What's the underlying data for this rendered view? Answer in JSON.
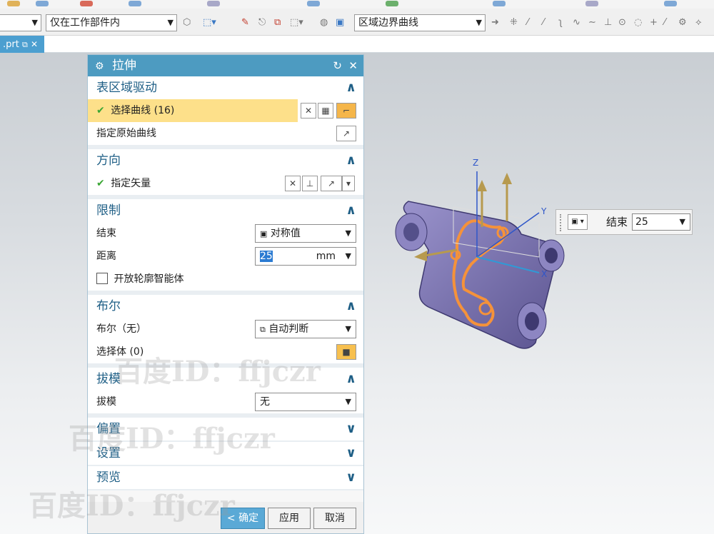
{
  "toolbar": {
    "filter_label": "仅在工作部件内",
    "curve_rule_label": "区域边界曲线"
  },
  "tab": {
    "label": ".prt"
  },
  "dialog": {
    "title": "拉伸",
    "sections": {
      "region": {
        "title": "表区域驱动",
        "select_curve": "选择曲线 (16)",
        "specify_original": "指定原始曲线"
      },
      "direction": {
        "title": "方向",
        "specify_vector": "指定矢量"
      },
      "limits": {
        "title": "限制",
        "end_label": "结束",
        "end_value": "对称值",
        "distance_label": "距离",
        "distance_value": "25",
        "distance_unit": "mm",
        "open_profile_label": "开放轮廓智能体"
      },
      "boolean": {
        "title": "布尔",
        "boolean_label": "布尔（无）",
        "boolean_value": "自动判断",
        "select_body": "选择体 (0)"
      },
      "draft": {
        "title": "拔模",
        "draft_label": "拔模",
        "draft_value": "无"
      },
      "offset": {
        "title": "偏置"
      },
      "settings": {
        "title": "设置"
      },
      "preview": {
        "title": "预览"
      }
    },
    "buttons": {
      "ok": "< 确定 >",
      "apply": "应用",
      "cancel": "取消"
    }
  },
  "floating": {
    "label": "结束",
    "value": "25"
  },
  "axes": {
    "x": "X",
    "y": "Y",
    "z": "Z"
  },
  "watermark": "百度ID：ffjczr",
  "colors": {
    "title_bar": "#4d9bc1",
    "highlight": "#fde08a",
    "part": "#7b74b0",
    "curve": "#f5923a",
    "accent_text": "#1f5f86"
  }
}
